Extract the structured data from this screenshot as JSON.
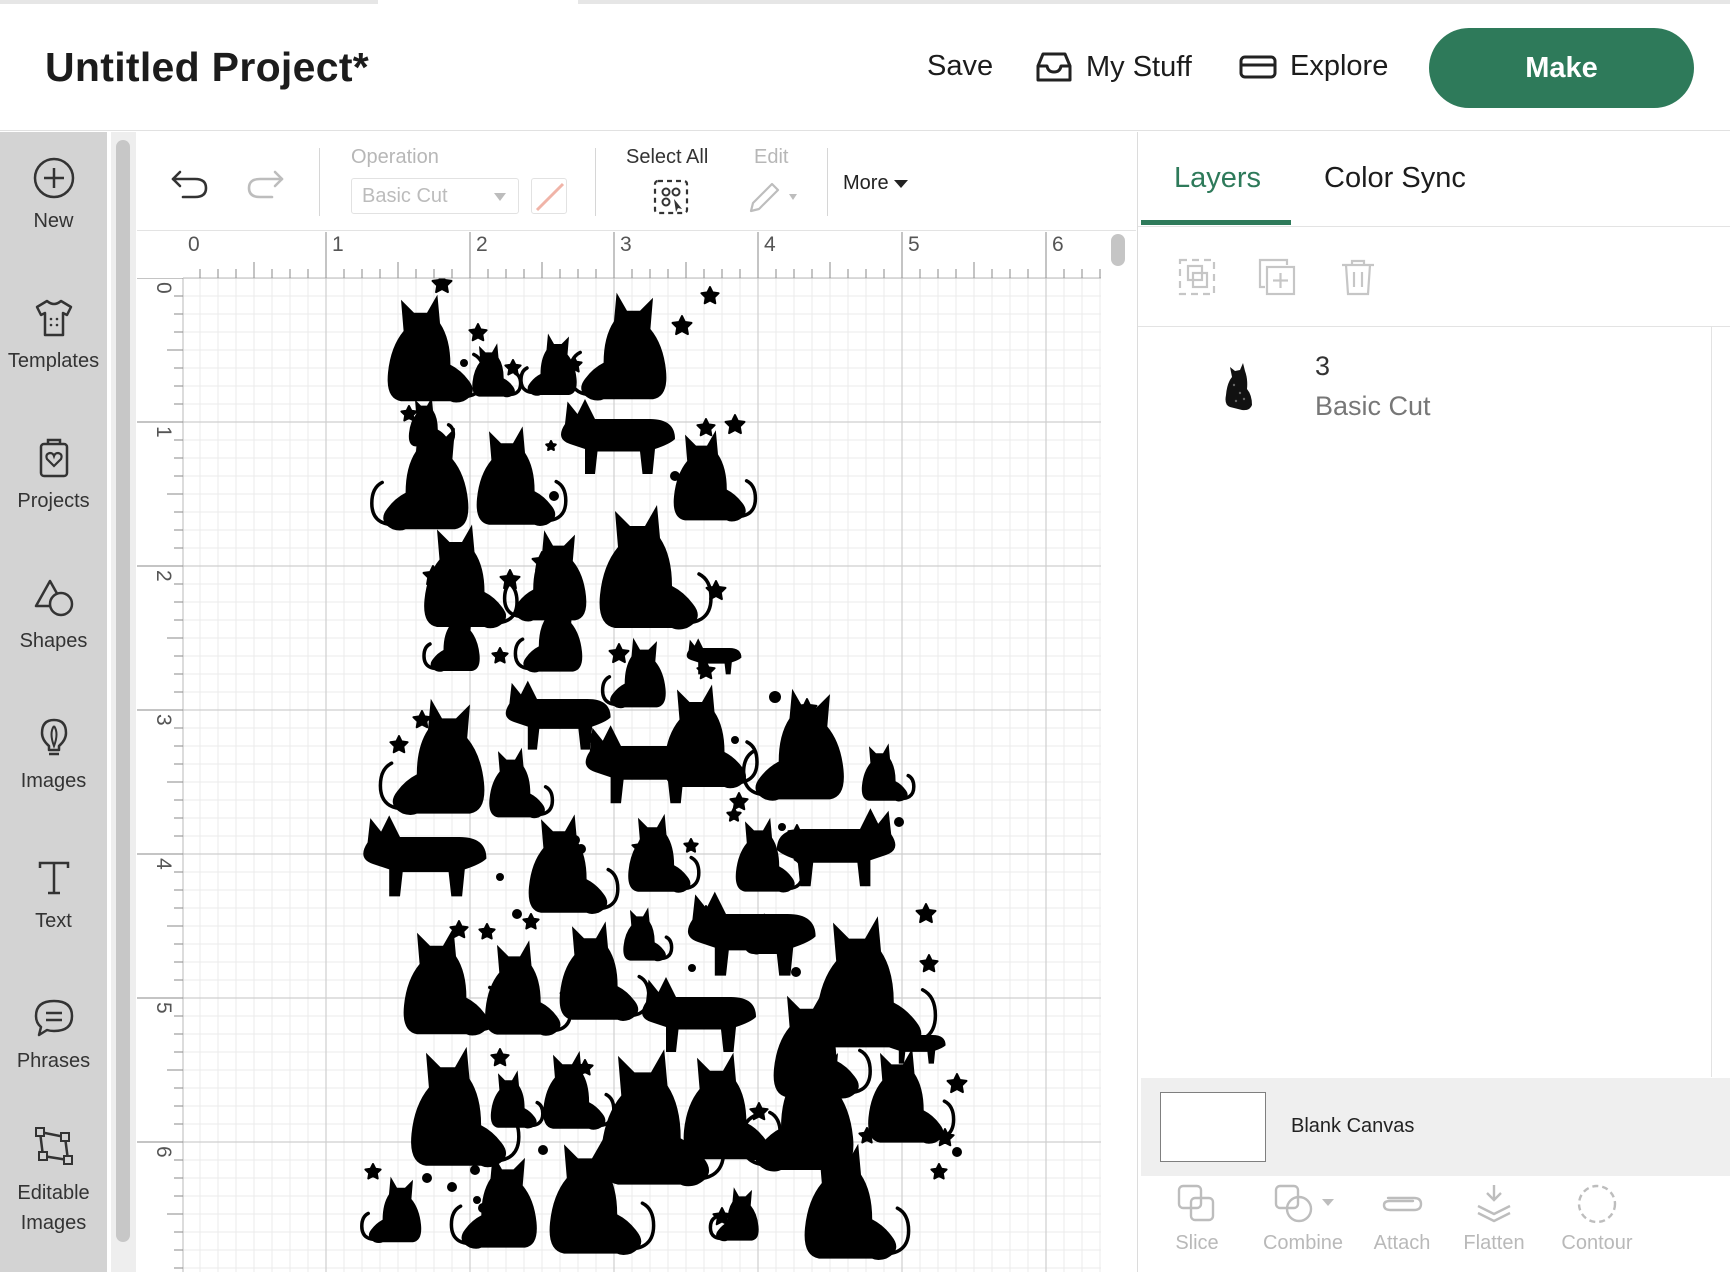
{
  "header": {
    "title": "Untitled Project*",
    "save_label": "Save",
    "mystuff_label": "My Stuff",
    "explore_label": "Explore",
    "make_label": "Make"
  },
  "sidebar": {
    "items": [
      {
        "label": "New",
        "icon": "plus-circle-icon"
      },
      {
        "label": "Templates",
        "icon": "tshirt-icon"
      },
      {
        "label": "Projects",
        "icon": "projects-icon"
      },
      {
        "label": "Shapes",
        "icon": "shapes-icon"
      },
      {
        "label": "Images",
        "icon": "lightbulb-icon"
      },
      {
        "label": "Text",
        "icon": "text-icon"
      },
      {
        "label": "Phrases",
        "icon": "speech-bubble-icon"
      },
      {
        "label": "Editable",
        "label2": "Images",
        "icon": "editable-images-icon"
      }
    ]
  },
  "toolbar": {
    "operation_label": "Operation",
    "operation_value": "Basic Cut",
    "select_all_label": "Select All",
    "edit_label": "Edit",
    "more_label": "More"
  },
  "ruler": {
    "horizontal": [
      "0",
      "1",
      "2",
      "3",
      "4",
      "5",
      "6"
    ],
    "vertical": [
      "0",
      "1",
      "2",
      "3",
      "4",
      "5",
      "6"
    ]
  },
  "right_panel": {
    "tabs": [
      "Layers",
      "Color Sync"
    ],
    "active_tab": "Layers",
    "layer": {
      "number": "3",
      "operation": "Basic Cut"
    },
    "blank_canvas_label": "Blank Canvas",
    "tools": [
      "Slice",
      "Combine",
      "Attach",
      "Flatten",
      "Contour"
    ]
  },
  "colors": {
    "accent": "#2e7a5a",
    "sidebar": "#d3d3d3",
    "grid_minor": "#ebebeb",
    "grid_major": "#cfcfcf",
    "design_fill": "#000000"
  }
}
